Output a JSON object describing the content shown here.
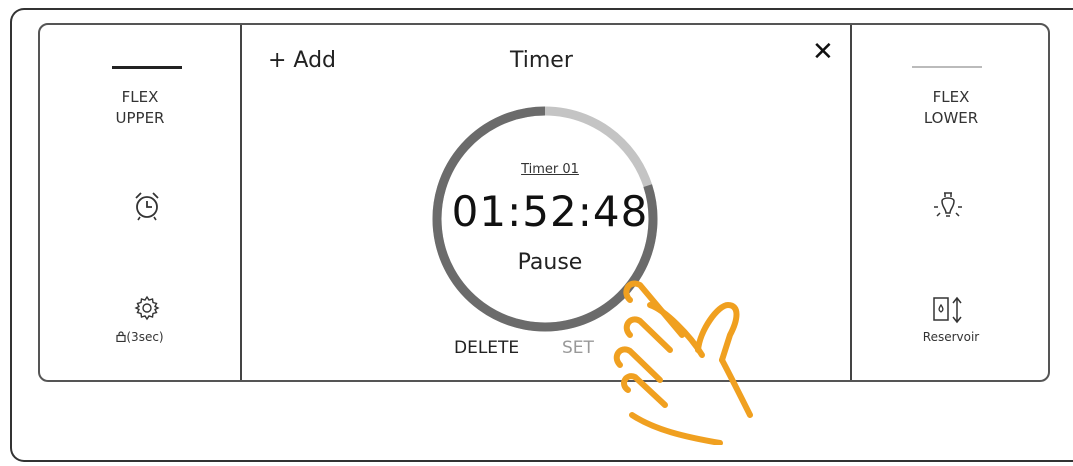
{
  "left_panel": {
    "zone_label": "FLEX\nUPPER",
    "lock_label": "(3sec)"
  },
  "timer": {
    "add_label": "+ Add",
    "title": "Timer",
    "close_label": "✕",
    "name": "Timer 01",
    "time": "01:52:48",
    "pause_label": "Pause",
    "delete_label": "DELETE",
    "set_label": "SET",
    "progress_fraction": 0.8
  },
  "right_panel": {
    "zone_label": "FLEX\nLOWER",
    "reservoir_label": "Reservoir"
  },
  "colors": {
    "accent_hand": "#f0a020",
    "ring_remaining": "#6b6b6b",
    "ring_elapsed": "#c4c4c4"
  },
  "icons": [
    "alarm-clock-icon",
    "gear-icon",
    "lock-icon",
    "light-bulb-icon",
    "water-reservoir-icon",
    "tap-gesture-hand-icon"
  ]
}
